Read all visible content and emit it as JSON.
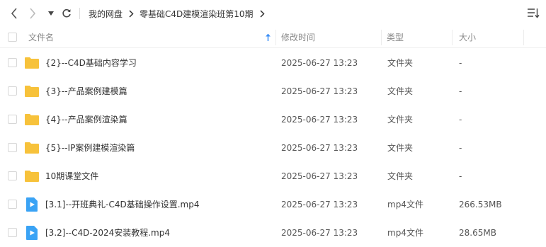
{
  "toolbar": {
    "breadcrumbs": [
      "我的网盘",
      "零基础C4D建模渲染班第10期"
    ]
  },
  "columns": {
    "name": "文件名",
    "modified": "修改时间",
    "type": "类型",
    "size": "大小"
  },
  "colors": {
    "folder": "#f7c23b",
    "video": "#3aa3f5"
  },
  "files": [
    {
      "name": "{2}--C4D基础内容学习",
      "modified": "2025-06-27 13:23",
      "type": "文件夹",
      "size": "-",
      "icon": "folder-icon"
    },
    {
      "name": "{3}--产品案例建模篇",
      "modified": "2025-06-27 13:23",
      "type": "文件夹",
      "size": "-",
      "icon": "folder-icon"
    },
    {
      "name": "{4}--产品案例渲染篇",
      "modified": "2025-06-27 13:23",
      "type": "文件夹",
      "size": "-",
      "icon": "folder-icon"
    },
    {
      "name": "{5}--IP案例建模渲染篇",
      "modified": "2025-06-27 13:23",
      "type": "文件夹",
      "size": "-",
      "icon": "folder-icon"
    },
    {
      "name": "10期课堂文件",
      "modified": "2025-06-27 13:23",
      "type": "文件夹",
      "size": "-",
      "icon": "folder-icon"
    },
    {
      "name": "[3.1]--开班典礼-C4D基础操作设置.mp4",
      "modified": "2025-06-27 13:23",
      "type": "mp4文件",
      "size": "266.53MB",
      "icon": "video-file-icon"
    },
    {
      "name": "[3.2]--C4D-2024安装教程.mp4",
      "modified": "2025-06-27 13:23",
      "type": "mp4文件",
      "size": "28.65MB",
      "icon": "video-file-icon"
    }
  ]
}
